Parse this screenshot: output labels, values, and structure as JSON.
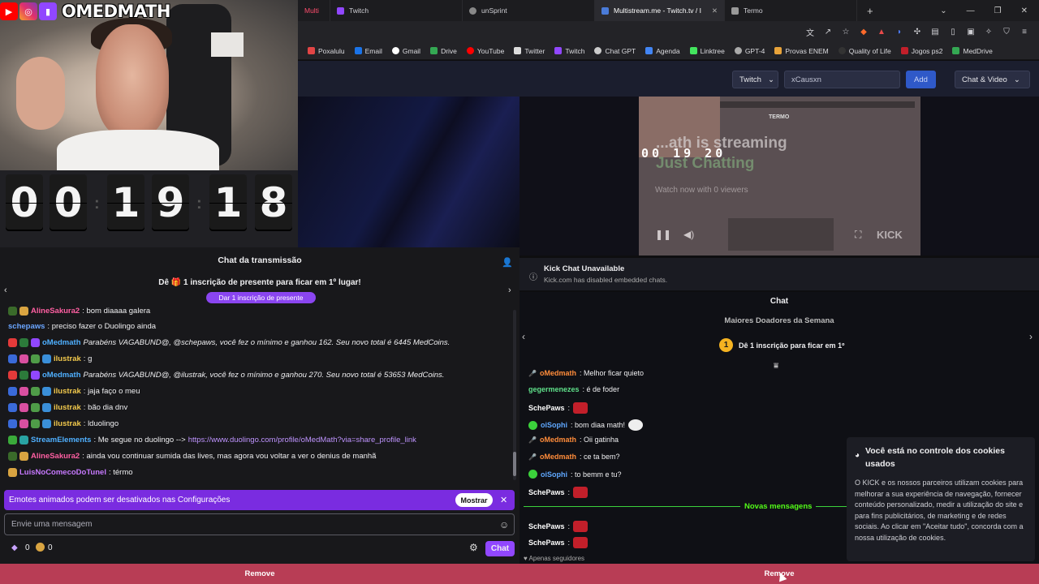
{
  "browser": {
    "multi_label": "Multi",
    "tabs": [
      {
        "label": "Twitch",
        "color": "#9147ff"
      },
      {
        "label": "unSprint",
        "color": "#888888"
      },
      {
        "label": "Multistream.me - Twitch.tv / I",
        "color": "#4a7bd8"
      },
      {
        "label": "Termo",
        "color": "#999999"
      }
    ],
    "new_tab": "+",
    "bookmarks": [
      {
        "label": "Poxalulu",
        "color": "#e24545"
      },
      {
        "label": "Email",
        "color": "#1a73e8"
      },
      {
        "label": "Gmail",
        "color": "#ffffff"
      },
      {
        "label": "Drive",
        "color": "#34a853"
      },
      {
        "label": "YouTube",
        "color": "#ff0000"
      },
      {
        "label": "Twitter",
        "color": "#dddddd"
      },
      {
        "label": "Twitch",
        "color": "#9147ff"
      },
      {
        "label": "Chat GPT",
        "color": "#cccccc"
      },
      {
        "label": "Agenda",
        "color": "#4285f4"
      },
      {
        "label": "Linktree",
        "color": "#43e55e"
      },
      {
        "label": "GPT-4",
        "color": "#aaaaaa"
      },
      {
        "label": "Provas ENEM",
        "color": "#e8a33a"
      },
      {
        "label": "Quality of Life",
        "color": "#333333"
      },
      {
        "label": "Jogos ps2",
        "color": "#c21f2a"
      },
      {
        "label": "MedDrive",
        "color": "#34a853"
      }
    ]
  },
  "multistream": {
    "platform": "Twitch",
    "channel_input": "xCausxn",
    "add_label": "Add",
    "layout": "Chat & Video"
  },
  "overlay": {
    "brand": "OMEDMATH",
    "timer_digits": [
      "0",
      "0",
      "1",
      "9",
      "1",
      "8"
    ]
  },
  "kick_video": {
    "streaming": "...ath is streaming",
    "category": "Just Chatting",
    "watch": "Watch now with 0 viewers",
    "timer": "00 19 20",
    "logo": "KICK",
    "termo": "TERMO"
  },
  "left_chat": {
    "title": "Chat da transmissão",
    "gift_banner": "Dê 🎁 1 inscrição de presente para ficar em 1º lugar!",
    "gift_button": "Dar 1 inscrição de presente",
    "messages": [
      {
        "user": "AlineSakura2",
        "color": "#ff5fa2",
        "text": ": bom diaaaa galera",
        "italic": false
      },
      {
        "user": "schepaws",
        "color": "#6aa5ff",
        "text": ": preciso fazer o Duolingo ainda",
        "italic": false
      },
      {
        "user": "oMedmath",
        "color": "#4fb0ff",
        "text": "Parabéns VAGABUND@, @schepaws, você fez o mínimo e ganhou 162. Seu novo total é 6445 MedCoins.",
        "italic": true
      },
      {
        "user": "ilustrak",
        "color": "#f2c94c",
        "text": ": g",
        "italic": false
      },
      {
        "user": "oMedmath",
        "color": "#4fb0ff",
        "text": "Parabéns VAGABUND@, @ilustrak, você fez o mínimo e ganhou 270. Seu novo total é 53653 MedCoins.",
        "italic": true
      },
      {
        "user": "ilustrak",
        "color": "#f2c94c",
        "text": ": jaja faço o meu",
        "italic": false
      },
      {
        "user": "ilustrak",
        "color": "#f2c94c",
        "text": ": bão dia dnv",
        "italic": false
      },
      {
        "user": "ilustrak",
        "color": "#f2c94c",
        "text": ": lduolingo",
        "italic": false
      },
      {
        "user": "StreamElements",
        "color": "#4fb0ff",
        "text": ": Me segue no duolingo --> ",
        "link": "https://www.duolingo.com/profile/oMedMath?via=share_profile_link",
        "italic": false
      },
      {
        "user": "AlineSakura2",
        "color": "#ff5fa2",
        "text": ": ainda vou continuar sumida das lives, mas agora vou voltar a ver o denius de manhã",
        "italic": false
      },
      {
        "user": "LuisNoComecoDoTunel",
        "color": "#c779ff",
        "text": ": térmo",
        "italic": false
      }
    ],
    "notice": "Emotes animados podem ser desativados nas Configurações",
    "notice_button": "Mostrar",
    "input_placeholder": "Envie uma mensagem",
    "points_a": "0",
    "points_b": "0",
    "chat_button": "Chat"
  },
  "right_chat": {
    "kick_unavailable_title": "Kick Chat Unavailable",
    "kick_unavailable_sub": "Kick.com has disabled embedded chats.",
    "title": "Chat",
    "top_donors": "Maiores Doadores da Semana",
    "donor_rank": "1",
    "donor_text": "Dê 1 inscrição para ficar em 1º",
    "messages": [
      {
        "user": "oMedmath",
        "color": "#ff8c3a",
        "text": ": Melhor ficar quieto",
        "emote": false
      },
      {
        "user": "gegermenezes",
        "color": "#5fe08a",
        "text": ": é de foder",
        "emote": false
      },
      {
        "user": "SchePaws",
        "color": "#ffffff",
        "text": ":",
        "emote": true
      },
      {
        "user": "oiSophi",
        "color": "#5fa8ff",
        "text": ": bom diaa math!",
        "emote": true
      },
      {
        "user": "oMedmath",
        "color": "#ff8c3a",
        "text": ": Oii gatinha",
        "emote": false
      },
      {
        "user": "oMedmath",
        "color": "#ff8c3a",
        "text": ": ce ta bem?",
        "emote": false
      },
      {
        "user": "oiSophi",
        "color": "#5fa8ff",
        "text": ": to bemm e tu?",
        "emote": false
      },
      {
        "user": "SchePaws",
        "color": "#ffffff",
        "text": ":",
        "emote": true
      },
      {
        "user": "SchePaws",
        "color": "#ffffff",
        "text": ":",
        "emote": true
      },
      {
        "user": "SchePaws",
        "color": "#ffffff",
        "text": ":",
        "emote": true
      }
    ],
    "new_messages": "Novas mensagens",
    "followers_only": "Apenas seguidores"
  },
  "cookie": {
    "title": "Você está no controle dos cookies usados",
    "body": "O KICK e os nossos parceiros utilizam cookies para melhorar a sua experiência de navegação, fornecer conteúdo personalizado, medir a utilização do site e para fins publicitários, de marketing e de redes sociais. Ao clicar em \"Aceitar tudo\", concorda com a nossa utilização de cookies."
  },
  "remove_left": "Remove",
  "remove_right": "Remove"
}
